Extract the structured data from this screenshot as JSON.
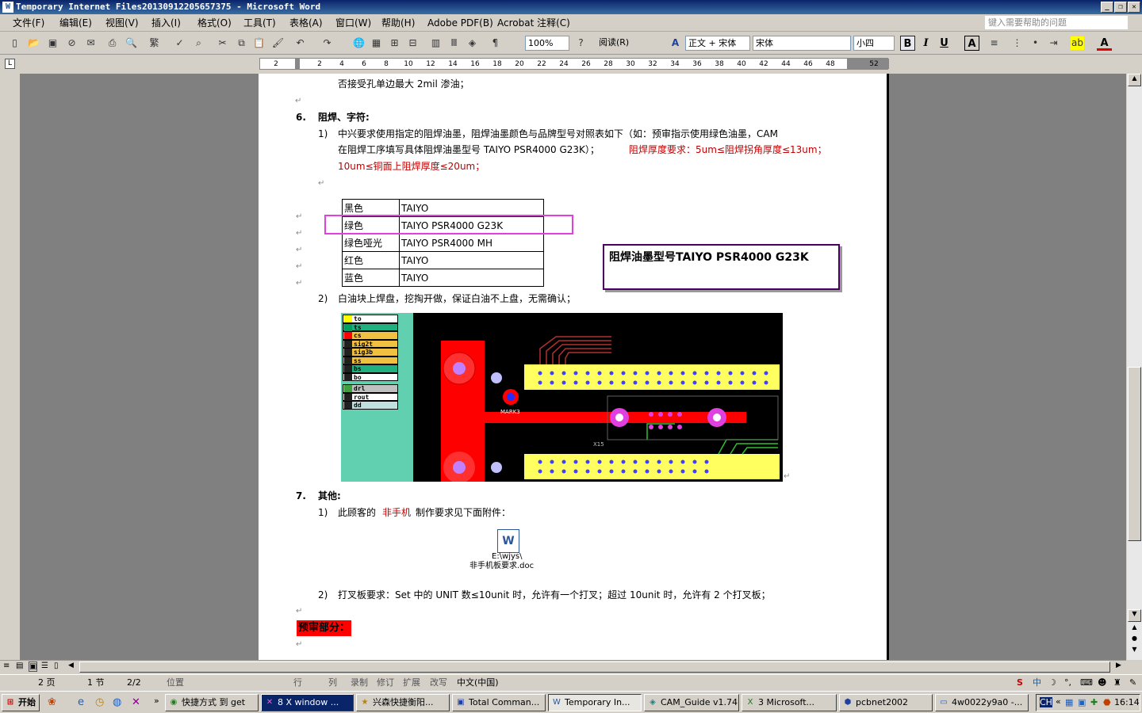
{
  "window": {
    "title": "Temporary Internet Files20130912205657375 - Microsoft Word",
    "minimize": "_",
    "restore": "❐",
    "close": "✕"
  },
  "menu": {
    "items": [
      "文件(F)",
      "编辑(E)",
      "视图(V)",
      "插入(I)",
      "格式(O)",
      "工具(T)",
      "表格(A)",
      "窗口(W)",
      "帮助(H)",
      "Adobe PDF(B)",
      "Acrobat 注释(C)"
    ],
    "help_placeholder": "键入需要帮助的问题"
  },
  "toolbar": {
    "zoom": "100%",
    "read_label": "阅读(R)",
    "style": "正文 + 宋体",
    "font": "宋体",
    "size": "小四",
    "bold": "B",
    "italic": "I",
    "underline": "U",
    "charborder": "A",
    "font_color": "A"
  },
  "ruler": {
    "ticks": [
      "2",
      "2",
      "4",
      "6",
      "8",
      "10",
      "12",
      "14",
      "16",
      "18",
      "20",
      "22",
      "24",
      "26",
      "28",
      "30",
      "32",
      "34",
      "36",
      "38",
      "40",
      "42",
      "44",
      "46",
      "48",
      "52"
    ]
  },
  "doc": {
    "line0": "否接受孔单边最大 2mil 渗油；",
    "sec6_num": "6.",
    "sec6_title": "阻焊、字符:",
    "s6_1_num": "1)",
    "s6_1_line1": "中兴要求使用指定的阻焊油墨，阻焊油墨颜色与品牌型号对照表如下（如：预审指示使用绿色油墨，CAM",
    "s6_1_line2a": "在阻焊工序填写具体阻焊油墨型号 TAIYO  PSR4000 G23K）；",
    "s6_1_line2b": "阻焊厚度要求：5um≤阻焊拐角厚度≤13um；",
    "s6_1_line3": "10um≤铜面上阻焊厚度≤20um；",
    "ink_table": [
      {
        "color": "黑色",
        "model": "TAIYO"
      },
      {
        "color": "绿色",
        "model": "TAIYO   PSR4000 G23K"
      },
      {
        "color": "绿色哑光",
        "model": "TAIYO   PSR4000 MH"
      },
      {
        "color": "红色",
        "model": "TAIYO"
      },
      {
        "color": "蓝色",
        "model": "TAIYO"
      }
    ],
    "callout": "阻焊油墨型号TAIYO  PSR4000 G23K",
    "s6_2_num": "2)",
    "s6_2": "白油块上焊盘，挖掏开做，保证白油不上盘，无需确认；",
    "layers": [
      {
        "name": "to",
        "color": "#ffff00",
        "bg": "#ffffff"
      },
      {
        "name": "ts",
        "color": "#00a060",
        "bg": "#20b080"
      },
      {
        "name": "cs",
        "color": "#ff0000",
        "bg": "#f0c040"
      },
      {
        "name": "sig2t",
        "color": "#202020",
        "bg": "#f0c040"
      },
      {
        "name": "sig3b",
        "color": "#202020",
        "bg": "#f0c040"
      },
      {
        "name": "ss",
        "color": "#202020",
        "bg": "#f0c040"
      },
      {
        "name": "bs",
        "color": "#202020",
        "bg": "#20b080"
      },
      {
        "name": "bo",
        "color": "#202020",
        "bg": "#ffffff"
      },
      {
        "name": "drl",
        "color": "#40a040",
        "bg": "#c0c0c0"
      },
      {
        "name": "rout",
        "color": "#202020",
        "bg": "#ffffff"
      },
      {
        "name": "dd",
        "color": "#202020",
        "bg": "#c0e0e0"
      }
    ],
    "pcb_mark": "MARK3",
    "pcb_ref": "X15",
    "sec7_num": "7.",
    "sec7_title": "其他:",
    "s7_1_num": "1)",
    "s7_1a": "此顾客的",
    "s7_1b": "非手机",
    "s7_1c": "制作要求见下面附件：",
    "attach_path": "E:\\wjys\\",
    "attach_name": "非手机板要求.doc",
    "s7_2_num": "2)",
    "s7_2": "打叉板要求：Set 中的 UNIT 数≤10unit 时，允许有一个打叉；超过 10unit 时，允许有 2 个打叉板；",
    "pre_review": "预审部分："
  },
  "status": {
    "page": "2 页",
    "section": "1 节",
    "pages": "2/2",
    "position": "位置",
    "line": "行",
    "col": "列",
    "rec": "录制",
    "rev": "修订",
    "ext": "扩展",
    "ovr": "改写",
    "lang": "中文(中国)"
  },
  "taskbar": {
    "start": "开始",
    "tasks": [
      "快捷方式 到 get",
      "8 X window ...",
      "兴森快捷衡阳...",
      "Total Comman...",
      "Temporary In...",
      "CAM_Guide v1.74",
      "3 Microsoft...",
      "pcbnet2002",
      "4w0022y9a0 -..."
    ],
    "clock": "16:14",
    "ime": "中"
  }
}
